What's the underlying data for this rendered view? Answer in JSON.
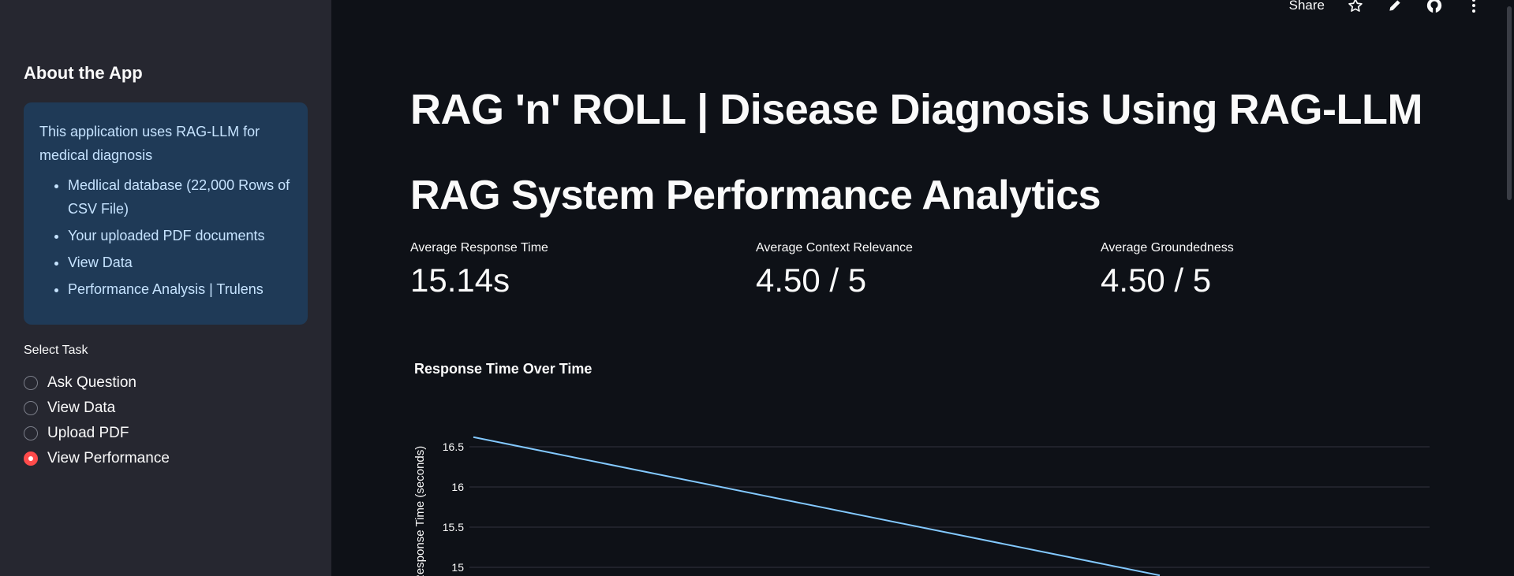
{
  "topbar": {
    "share_label": "Share"
  },
  "sidebar": {
    "title": "About the App",
    "info": {
      "intro": "This application uses RAG-LLM for medical diagnosis",
      "items": [
        "Medlical database (22,000 Rows of CSV File)",
        "Your uploaded PDF documents",
        "View Data",
        "Performance Analysis | Trulens"
      ]
    },
    "select_label": "Select Task",
    "tasks": [
      {
        "label": "Ask Question",
        "selected": false
      },
      {
        "label": "View Data",
        "selected": false
      },
      {
        "label": "Upload PDF",
        "selected": false
      },
      {
        "label": "View Performance",
        "selected": true
      }
    ]
  },
  "main": {
    "title": "RAG 'n' ROLL | Disease Diagnosis Using RAG-LLM",
    "subtitle": "RAG System Performance Analytics",
    "metrics": [
      {
        "label": "Average Response Time",
        "value": "15.14s"
      },
      {
        "label": "Average Context Relevance",
        "value": "4.50 / 5"
      },
      {
        "label": "Average Groundedness",
        "value": "4.50 / 5"
      }
    ]
  },
  "chart_data": {
    "type": "line",
    "title": "Response Time Over Time",
    "ylabel": "Response Time (seconds)",
    "y_ticks": [
      "16.5",
      "16",
      "15.5",
      "15"
    ],
    "series": [
      {
        "x": [
          0,
          1
        ],
        "y": [
          16.62,
          14.9
        ],
        "color": "#83c9ff"
      }
    ]
  },
  "colors": {
    "background": "#0e1117",
    "sidebar": "#262730",
    "info_box": "#1f3a57",
    "accent": "#ff4b4b",
    "line": "#83c9ff"
  }
}
